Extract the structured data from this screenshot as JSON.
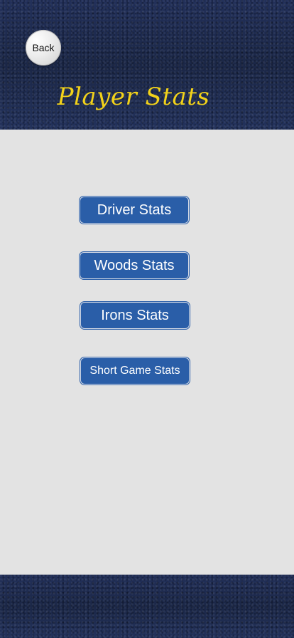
{
  "header": {
    "back_label": "Back",
    "title": "Player Stats"
  },
  "menu": {
    "items": [
      {
        "label": "Driver Stats"
      },
      {
        "label": "Woods Stats"
      },
      {
        "label": "Irons Stats"
      },
      {
        "label": "Short Game Stats"
      }
    ]
  },
  "colors": {
    "header_background": "#1f2c4e",
    "title": "#f2d21a",
    "button_background": "#2a5ea8",
    "content_background": "#e3e3e3"
  }
}
